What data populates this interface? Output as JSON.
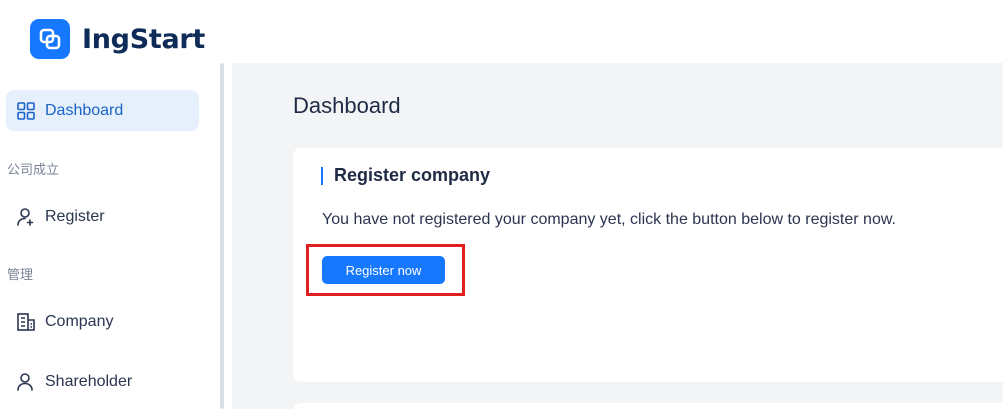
{
  "brand": {
    "name": "IngStart",
    "logo_icon": "square-layers-icon",
    "accent": "#1677ff"
  },
  "sidebar": {
    "items": [
      {
        "label": "Dashboard",
        "icon": "grid-icon",
        "active": true
      },
      {
        "label": "Register",
        "icon": "user-add-icon"
      },
      {
        "label": "Company",
        "icon": "building-icon"
      },
      {
        "label": "Shareholder",
        "icon": "users-icon"
      }
    ],
    "groups": [
      {
        "label": "公司成立"
      },
      {
        "label": "管理"
      }
    ]
  },
  "main": {
    "title": "Dashboard",
    "card": {
      "title": "Register company",
      "description": "You have not registered your company yet, click the button below to register now.",
      "button_label": "Register now"
    }
  },
  "colors": {
    "highlight": "#e02020",
    "active_bg": "#e6f0fc"
  }
}
